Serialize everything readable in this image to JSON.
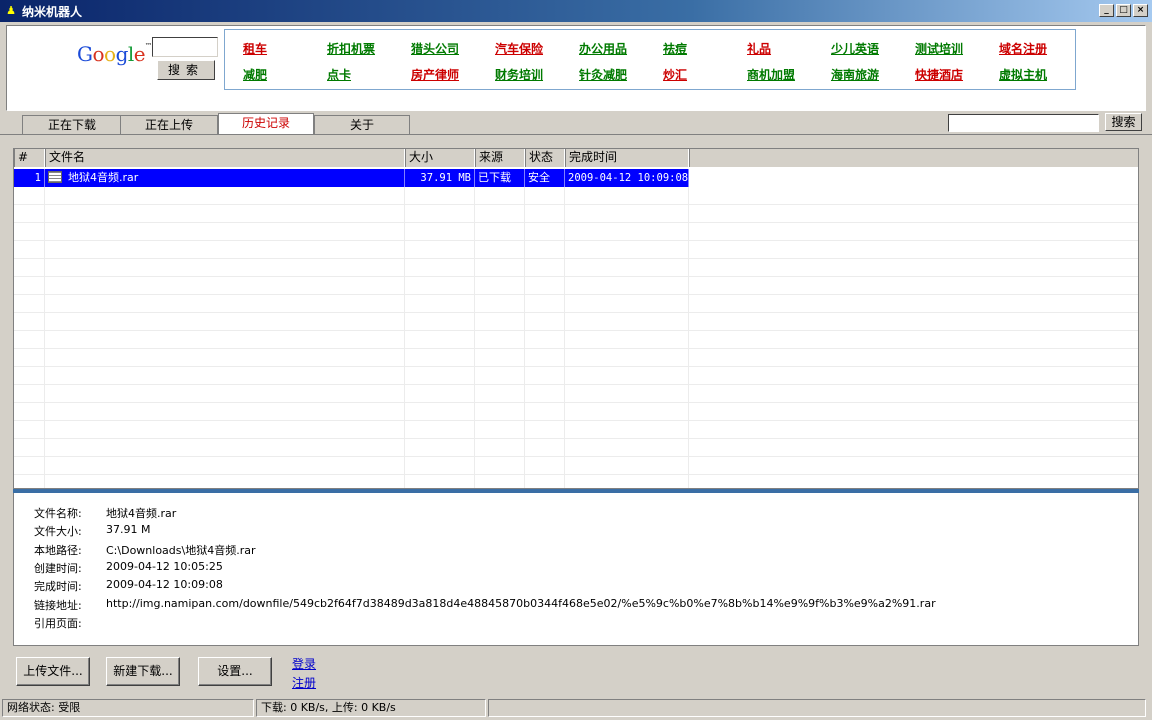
{
  "window": {
    "title": "纳米机器人",
    "min_label": "_",
    "max_label": "□",
    "close_label": "×"
  },
  "ad": {
    "google_logo": "Google",
    "google_tm": "™",
    "search_button": "搜索",
    "links": [
      {
        "text": "租车",
        "color": "red"
      },
      {
        "text": "折扣机票",
        "color": "green"
      },
      {
        "text": "猎头公司",
        "color": "green"
      },
      {
        "text": "汽车保险",
        "color": "red"
      },
      {
        "text": "办公用品",
        "color": "green"
      },
      {
        "text": "祛痘",
        "color": "green"
      },
      {
        "text": "礼品",
        "color": "red"
      },
      {
        "text": "少儿英语",
        "color": "green"
      },
      {
        "text": "测试培训",
        "color": "green"
      },
      {
        "text": "域名注册",
        "color": "red"
      },
      {
        "text": "减肥",
        "color": "green"
      },
      {
        "text": "点卡",
        "color": "green"
      },
      {
        "text": "房产律师",
        "color": "red"
      },
      {
        "text": "财务培训",
        "color": "green"
      },
      {
        "text": "针灸减肥",
        "color": "green"
      },
      {
        "text": "炒汇",
        "color": "red"
      },
      {
        "text": "商机加盟",
        "color": "green"
      },
      {
        "text": "海南旅游",
        "color": "green"
      },
      {
        "text": "快捷酒店",
        "color": "red"
      },
      {
        "text": "虚拟主机",
        "color": "green"
      }
    ]
  },
  "tabs": [
    {
      "label": "正在下载"
    },
    {
      "label": "正在上传"
    },
    {
      "label": "历史记录"
    },
    {
      "label": "关于"
    }
  ],
  "search": {
    "button": "搜索",
    "value": ""
  },
  "table": {
    "headers": [
      "#",
      "文件名",
      "大小",
      "来源",
      "状态",
      "完成时间"
    ],
    "rows": [
      {
        "num": "1",
        "name": "地狱4音频.rar",
        "size": "37.91 MB",
        "source": "已下载",
        "status": "安全",
        "time": "2009-04-12 10:09:08"
      }
    ]
  },
  "details": {
    "labels": [
      "文件名称:",
      "文件大小:",
      "本地路径:",
      "创建时间:",
      "完成时间:",
      "链接地址:",
      "引用页面:"
    ],
    "values": [
      "地狱4音频.rar",
      "37.91 M",
      "C:\\Downloads\\地狱4音频.rar",
      "2009-04-12 10:05:25",
      "2009-04-12 10:09:08",
      "http://img.namipan.com/downfile/549cb2f64f7d38489d3a818d4e48845870b0344f468e5e02/%e5%9c%b0%e7%8b%b14%e9%9f%b3%e9%a2%91.rar",
      ""
    ]
  },
  "buttons": {
    "upload": "上传文件...",
    "new_download": "新建下载...",
    "settings": "设置..."
  },
  "links": {
    "login": "登录",
    "register": "注册"
  },
  "status": {
    "network": "网络状态: 受限",
    "speed": "下载: 0 KB/s, 上传: 0 KB/s"
  }
}
